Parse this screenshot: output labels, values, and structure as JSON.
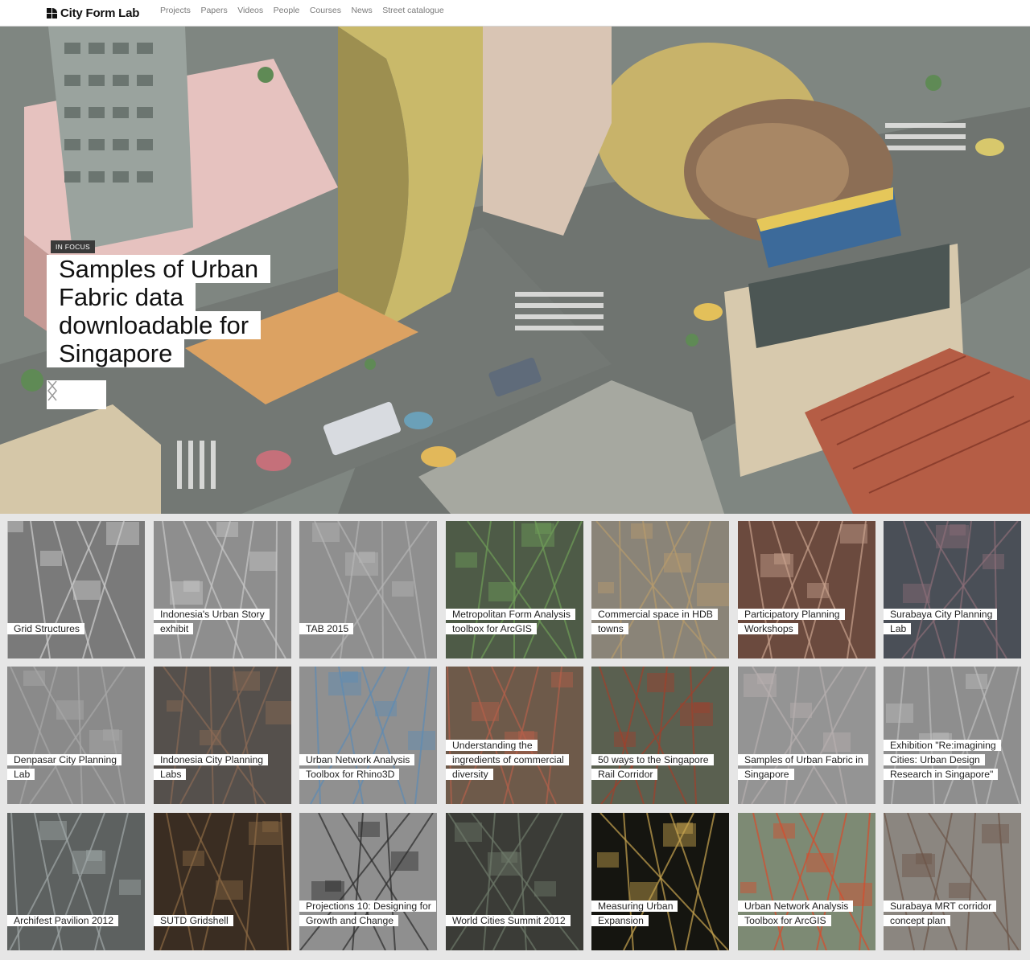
{
  "header": {
    "logo_text": "City Form Lab",
    "nav": [
      "Projects",
      "Papers",
      "Videos",
      "People",
      "Courses",
      "News",
      "Street catalogue"
    ]
  },
  "hero": {
    "badge": "IN FOCUS",
    "title_lines": [
      "Samples of Urban",
      "Fabric data",
      "downloadable for",
      "Singapore"
    ],
    "prev_icon": "chevron-left-icon",
    "next_icon": "chevron-right-icon",
    "scroll_icon": "chevron-down-icon"
  },
  "tiles": [
    {
      "title": "Grid Structures",
      "bg": "#7a7a7a",
      "accent": "#cfcfcf"
    },
    {
      "title": "Indonesia's Urban Story exhibit",
      "bg": "#8e8e8e",
      "accent": "#c8c8c8"
    },
    {
      "title": "TAB 2015",
      "bg": "#8f8f8f",
      "accent": "#b5b5b5"
    },
    {
      "title": "Metropolitan Form Analysis toolbox for ArcGIS",
      "bg": "#4e5b47",
      "accent": "#6f9e58"
    },
    {
      "title": "Commercial space in HDB towns",
      "bg": "#8a8478",
      "accent": "#b79b6c"
    },
    {
      "title": "Participatory Planning Workshops",
      "bg": "#6b4a3e",
      "accent": "#c8a28d"
    },
    {
      "title": "Surabaya City Planning Lab",
      "bg": "#4a4f57",
      "accent": "#8c6d77"
    },
    {
      "title": "Denpasar City Planning Lab",
      "bg": "#8a8a8a",
      "accent": "#a8a8a8"
    },
    {
      "title": "Indonesia City Planning Labs",
      "bg": "#55504c",
      "accent": "#8b6a55"
    },
    {
      "title": "Urban Network Analysis Toolbox for  Rhino3D",
      "bg": "#909090",
      "accent": "#5d8bb4"
    },
    {
      "title": "Understanding the ingredients of commercial diversity",
      "bg": "#6e5a4a",
      "accent": "#b5604a"
    },
    {
      "title": "50 ways to the Singapore Rail Corridor",
      "bg": "#5a6050",
      "accent": "#a0402c"
    },
    {
      "title": "Samples of Urban Fabric in Singapore",
      "bg": "#949494",
      "accent": "#b7b0b0"
    },
    {
      "title": "Exhibition \"Re:imagining Cities: Urban Design Research in Singapore\"",
      "bg": "#8e8e8e",
      "accent": "#bdbdbd"
    },
    {
      "title": "Archifest Pavilion 2012",
      "bg": "#5d6160",
      "accent": "#a0a8a8"
    },
    {
      "title": "SUTD Gridshell",
      "bg": "#3a2d22",
      "accent": "#8c6a44"
    },
    {
      "title": "Projections 10: Designing for Growth and Change",
      "bg": "#8f8f8f",
      "accent": "#2a2a2a"
    },
    {
      "title": "World Cities Summit 2012",
      "bg": "#3b3c37",
      "accent": "#6e7a6a"
    },
    {
      "title": "Measuring Urban Expansion",
      "bg": "#151510",
      "accent": "#c9a650"
    },
    {
      "title": "Urban Network Analysis Toolbox for ArcGIS",
      "bg": "#7d8a74",
      "accent": "#d84c2c"
    },
    {
      "title": "Surabaya MRT corridor concept plan",
      "bg": "#8b8680",
      "accent": "#6c5548"
    }
  ]
}
